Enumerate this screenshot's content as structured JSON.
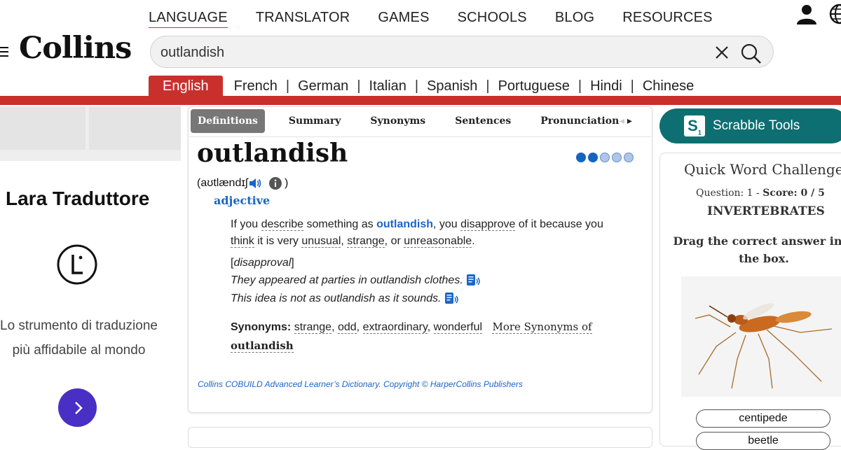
{
  "topnav": [
    "LANGUAGE",
    "TRANSLATOR",
    "GAMES",
    "SCHOOLS",
    "BLOG",
    "RESOURCES"
  ],
  "logo": "Collins",
  "search": {
    "value": "outlandish"
  },
  "languages": [
    "English",
    "French",
    "German",
    "Italian",
    "Spanish",
    "Portuguese",
    "Hindi",
    "Chinese"
  ],
  "ad": {
    "title": "Lara Traduttore",
    "desc_line1": "Lo strumento di traduzione",
    "desc_line2": "più affidabile al mondo",
    "button_icon": "chevron-right-icon",
    "button_color": "#4a2fc4"
  },
  "entry": {
    "tabs": [
      "Definitions",
      "Summary",
      "Synonyms",
      "Sentences",
      "Pronunciation"
    ],
    "headword": "outlandish",
    "frequency_level": 2,
    "frequency_max": 5,
    "pronunciation": "aʊtlændɪʃ",
    "pos": "adjective",
    "definition": {
      "p1": "If you ",
      "w1": "describe",
      "p2": " something as ",
      "hl": "outlandish",
      "p3": ", you ",
      "w2": "disapprove",
      "p4": " of it because you ",
      "w3": "think",
      "p5": " it is very ",
      "w4": "unusual",
      "p6": ", ",
      "w5": "strange",
      "p7": ", or ",
      "w6": "unreasonable",
      "p8": "."
    },
    "note": "disapproval",
    "examples": [
      "They appeared at parties in outlandish clothes.",
      "This idea is not as outlandish as it sounds."
    ],
    "synonyms_label": "Synonyms:",
    "synonyms": [
      "strange",
      "odd",
      "extraordinary",
      "wonderful"
    ],
    "more_synonyms": "More Synonyms of",
    "more_word": "outlandish",
    "copyright": "Collins COBUILD Advanced Learner’s Dictionary. Copyright © HarperCollins Publishers"
  },
  "scrabble": {
    "tile": "S",
    "tile_sub": "1",
    "label": "Scrabble Tools",
    "color": "#0d6f72"
  },
  "quiz": {
    "title": "Quick Word Challenge",
    "question_label": "Question: 1",
    "dash": " - ",
    "score": "Score: 0 / 5",
    "category": "INVERTEBRATES",
    "instruction": "Drag the correct answer into the box.",
    "answers": [
      "centipede",
      "beetle"
    ]
  },
  "colors": {
    "brand_red": "#c9302c",
    "link_blue": "#1a66c8"
  }
}
